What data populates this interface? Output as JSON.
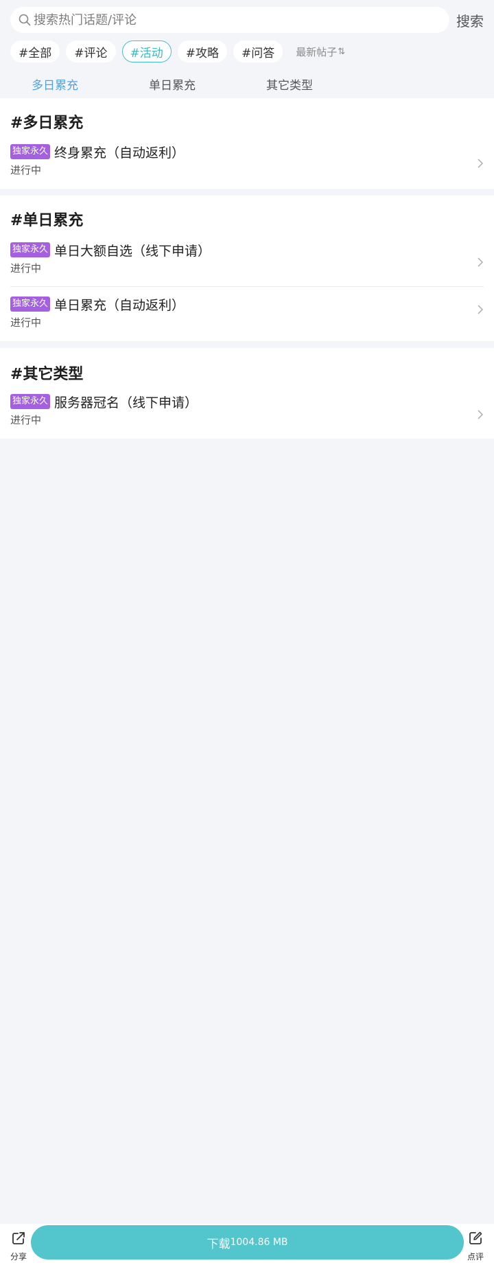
{
  "search": {
    "placeholder": "搜索热门话题/评论",
    "button_label": "搜索"
  },
  "chips": [
    {
      "label": "#全部",
      "active": false
    },
    {
      "label": "#评论",
      "active": false
    },
    {
      "label": "#活动",
      "active": true
    },
    {
      "label": "#攻略",
      "active": false
    },
    {
      "label": "#问答",
      "active": false
    }
  ],
  "sort": {
    "label": "最新帖子",
    "arrow": "⇅"
  },
  "tabs": [
    {
      "label": "多日累充",
      "active": true
    },
    {
      "label": "单日累充",
      "active": false
    },
    {
      "label": "其它类型",
      "active": false
    }
  ],
  "sections": [
    {
      "title": "#多日累充",
      "items": [
        {
          "badge": "独家永久",
          "title": "终身累充（自动返利）",
          "status": "进行中"
        }
      ]
    },
    {
      "title": "#单日累充",
      "items": [
        {
          "badge": "独家永久",
          "title": "单日大额自选（线下申请）",
          "status": "进行中"
        },
        {
          "badge": "独家永久",
          "title": "单日累充（自动返利）",
          "status": "进行中"
        }
      ]
    },
    {
      "title": "#其它类型",
      "items": [
        {
          "badge": "独家永久",
          "title": "服务器冠名（线下申请）",
          "status": "进行中"
        }
      ]
    }
  ],
  "bottom": {
    "share_label": "分享",
    "download_label": "下载",
    "download_size": "1004.86 MB",
    "review_label": "点评"
  },
  "colors": {
    "accent": "#52c5cd",
    "tab_active": "#4fa3e0",
    "badge": "#a460e0",
    "background": "#f3f5f8"
  }
}
